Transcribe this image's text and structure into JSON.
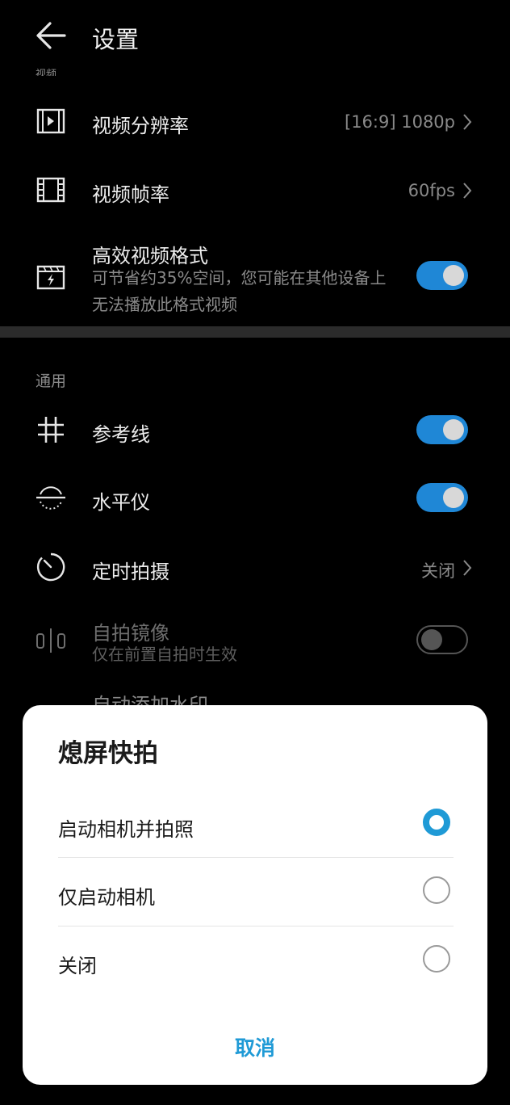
{
  "header": {
    "title": "设置",
    "cut_label": "视频"
  },
  "video": {
    "resolution": {
      "label": "视频分辨率",
      "value": "[16:9] 1080p"
    },
    "framerate": {
      "label": "视频帧率",
      "value": "60fps"
    },
    "efficient": {
      "label": "高效视频格式",
      "desc": "可节省约35%空间，您可能在其他设备上无法播放此格式视频",
      "on": true
    }
  },
  "general": {
    "section_label": "通用",
    "grid": {
      "label": "参考线",
      "on": true
    },
    "level": {
      "label": "水平仪",
      "on": true
    },
    "timer": {
      "label": "定时拍摄",
      "value": "关闭"
    },
    "mirror": {
      "label": "自拍镜像",
      "desc": "仅在前置自拍时生效",
      "on": false
    },
    "peek_label": "自动添加水印"
  },
  "dialog": {
    "title": "熄屏快拍",
    "options": [
      {
        "label": "启动相机并拍照",
        "selected": true
      },
      {
        "label": "仅启动相机",
        "selected": false
      },
      {
        "label": "关闭",
        "selected": false
      }
    ],
    "cancel": "取消"
  },
  "colors": {
    "accent": "#1f87d6",
    "dialog_accent": "#1f9ad6",
    "background": "#000000"
  }
}
